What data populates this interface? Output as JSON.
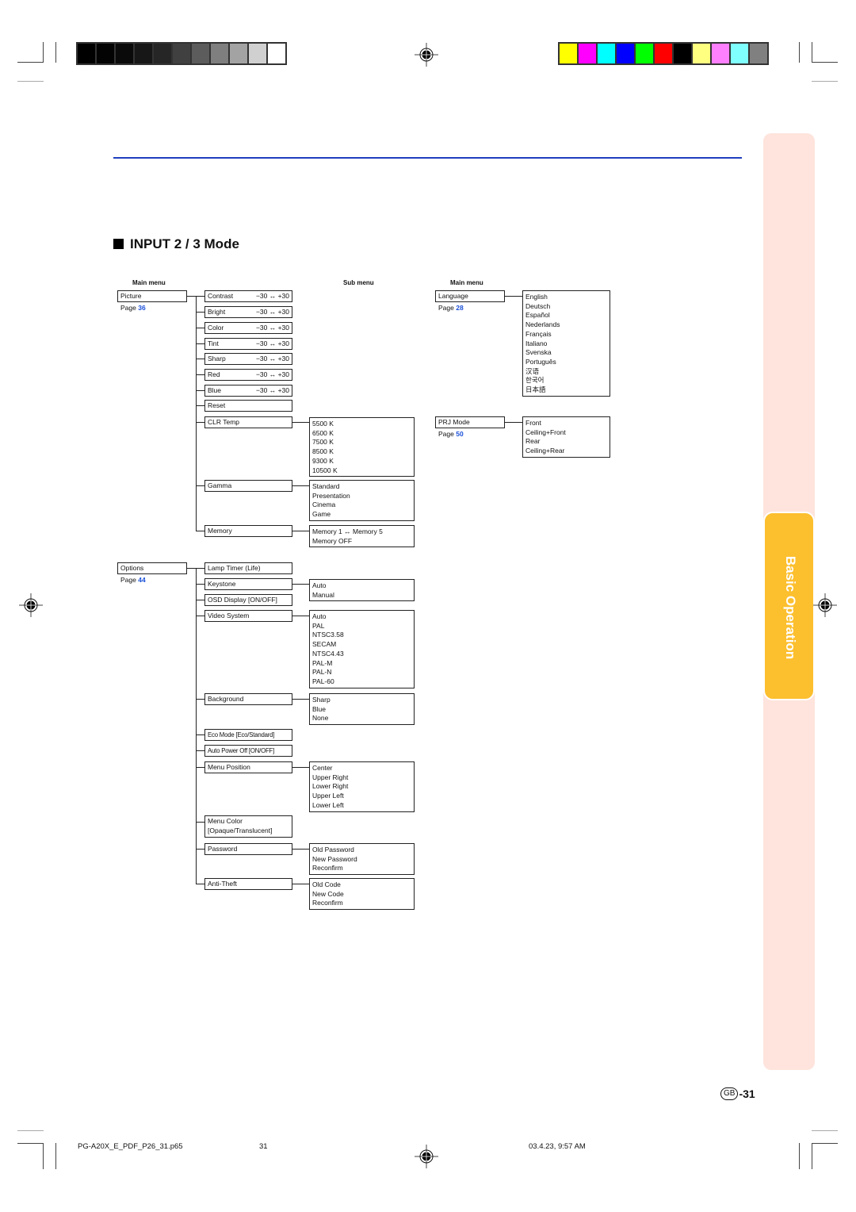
{
  "print_marks": {
    "gray_swatches": [
      "#000000",
      "#030303",
      "#0a0a0a",
      "#171717",
      "#262626",
      "#404040",
      "#5c5c5c",
      "#7f7f7f",
      "#a3a3a3",
      "#d0d0d0",
      "#ffffff"
    ],
    "color_swatches": [
      "#ffff00",
      "#ff00ff",
      "#00ffff",
      "#0000ff",
      "#00ff00",
      "#ff0000",
      "#000000",
      "#ffff80",
      "#ff80ff",
      "#80ffff",
      "#808080"
    ]
  },
  "section_title": "INPUT 2 / 3 Mode",
  "side_tab": {
    "label": "Basic Operation",
    "color": "#fcbf2e",
    "bg": "#fee4dc"
  },
  "accent_rule_color": "#1f3fbf",
  "headers": {
    "main_menu_left": "Main menu",
    "sub_menu": "Sub menu",
    "main_menu_right": "Main menu"
  },
  "page_prefix": "Page",
  "left_tree": {
    "picture": {
      "label": "Picture",
      "page": "36",
      "items": [
        {
          "label": "Contrast",
          "range": "−30 ↔ +30"
        },
        {
          "label": "Bright",
          "range": "−30 ↔ +30"
        },
        {
          "label": "Color",
          "range": "−30 ↔ +30"
        },
        {
          "label": "Tint",
          "range": "−30 ↔ +30"
        },
        {
          "label": "Sharp",
          "range": "−30 ↔ +30"
        },
        {
          "label": "Red",
          "range": "−30 ↔ +30"
        },
        {
          "label": "Blue",
          "range": "−30 ↔ +30"
        },
        {
          "label": "Reset"
        },
        {
          "label": "CLR Temp",
          "options": [
            "5500 K",
            "6500 K",
            "7500 K",
            "8500 K",
            "9300 K",
            "10500 K"
          ]
        },
        {
          "label": "Gamma",
          "options": [
            "Standard",
            "Presentation",
            "Cinema",
            "Game"
          ]
        },
        {
          "label": "Memory",
          "options": [
            "Memory 1 ↔ Memory 5",
            "Memory OFF"
          ]
        }
      ]
    },
    "options": {
      "label": "Options",
      "page": "44",
      "items": [
        {
          "label": "Lamp Timer (Life)"
        },
        {
          "label": "Keystone",
          "options": [
            "Auto",
            "Manual"
          ]
        },
        {
          "label": "OSD Display [ON/OFF]"
        },
        {
          "label": "Video System",
          "options": [
            "Auto",
            "PAL",
            "NTSC3.58",
            "SECAM",
            "NTSC4.43",
            "PAL-M",
            "PAL-N",
            "PAL-60"
          ]
        },
        {
          "label": "Background",
          "options": [
            "Sharp",
            "Blue",
            "None"
          ]
        },
        {
          "label": "Eco Mode [Eco/Standard]"
        },
        {
          "label": "Auto Power Off [ON/OFF]"
        },
        {
          "label": "Menu Position",
          "options": [
            "Center",
            "Upper Right",
            "Lower Right",
            "Upper Left",
            "Lower Left"
          ]
        },
        {
          "label": "Menu Color",
          "label2": "[Opaque/Translucent]"
        },
        {
          "label": "Password",
          "options": [
            "Old Password",
            "New Password",
            "Reconfirm"
          ]
        },
        {
          "label": "Anti-Theft",
          "options": [
            "Old Code",
            "New Code",
            "Reconfirm"
          ]
        }
      ]
    }
  },
  "right_tree": {
    "language": {
      "label": "Language",
      "page": "28",
      "options": [
        "English",
        "Deutsch",
        "Español",
        "Nederlands",
        "Français",
        "Italiano",
        "Svenska",
        "Português",
        "汉语",
        "한국어",
        "日本語"
      ]
    },
    "prj_mode": {
      "label": "PRJ Mode",
      "page": "50",
      "options": [
        "Front",
        "Ceiling+Front",
        "Rear",
        "Ceiling+Rear"
      ]
    }
  },
  "page_number": {
    "badge": "GB",
    "number": "-31"
  },
  "footer": {
    "file": "PG-A20X_E_PDF_P26_31.p65",
    "page": "31",
    "timestamp": "03.4.23, 9:57 AM"
  }
}
